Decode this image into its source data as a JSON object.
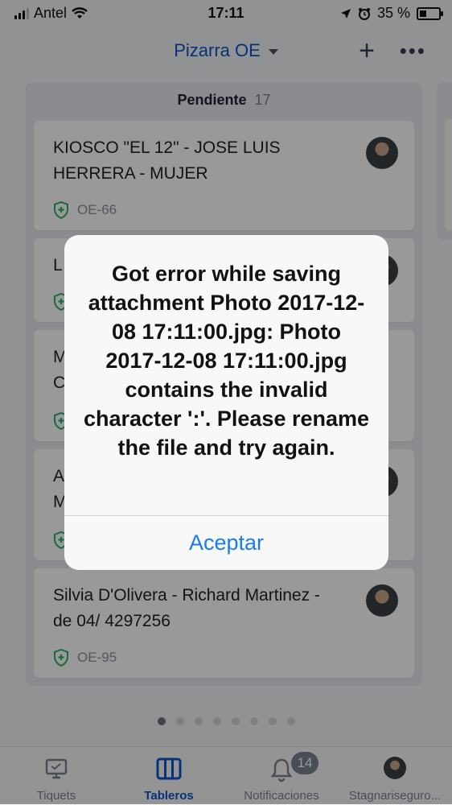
{
  "status_bar": {
    "carrier": "Antel",
    "time": "17:11",
    "battery": "35 %",
    "battery_level": 0.35
  },
  "header": {
    "board_name": "Pizarra OE"
  },
  "column": {
    "title": "Pendiente",
    "count": "17",
    "cards": [
      {
        "title": "KIOSCO \"EL 12\" - JOSE LUIS HERRERA -  MUJER",
        "key": "OE-66"
      },
      {
        "title": "L",
        "key": ""
      },
      {
        "title": "M\nC",
        "key": ""
      },
      {
        "title": "A\nM",
        "key": ""
      },
      {
        "title": "Silvia D'Olivera - Richard Martinez - de 04/ 4297256",
        "key": "OE-95"
      }
    ]
  },
  "pagination": {
    "pages": 8,
    "active_index": 0
  },
  "tabbar": {
    "tabs": [
      {
        "label": "Tiquets",
        "icon": "monitor-icon"
      },
      {
        "label": "Tableros",
        "icon": "board-columns-icon"
      },
      {
        "label": "Notificaciones",
        "icon": "bell-icon"
      },
      {
        "label": "Stagnariseguro...",
        "icon": "avatar"
      }
    ],
    "notifications_badge": "14"
  },
  "dialog": {
    "message": "Got error while saving attachment Photo 2017-12-08 17:11:00.jpg: Photo 2017-12-08 17:11:00.jpg contains the invalid character ':'. Please rename the file and try again.",
    "button_label": "Aceptar"
  },
  "colors": {
    "accent": "#0b56c8",
    "dialog_button": "#1a7cf0"
  }
}
